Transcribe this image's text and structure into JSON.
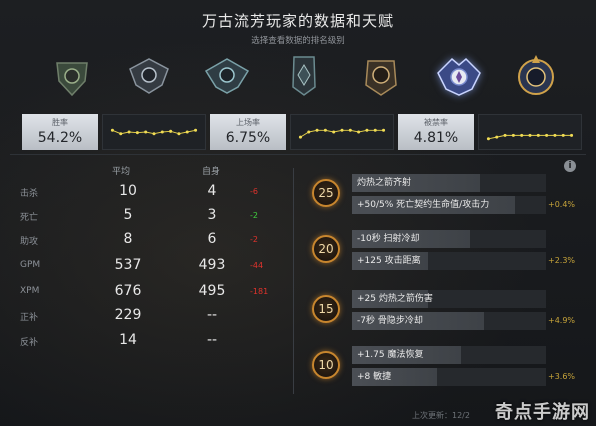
{
  "header": {
    "title": "万古流芳玩家的数据和天赋",
    "subtitle": "选择查看数据的排名级别"
  },
  "tiers": [
    {
      "icon": "herald-medal-icon",
      "active": false
    },
    {
      "icon": "guardian-medal-icon",
      "active": false
    },
    {
      "icon": "crusader-medal-icon",
      "active": false
    },
    {
      "icon": "archon-medal-icon",
      "active": false
    },
    {
      "icon": "legend-medal-icon",
      "active": false
    },
    {
      "icon": "ancient-medal-icon",
      "active": true
    },
    {
      "icon": "divine-medal-icon",
      "active": false
    }
  ],
  "stat_cards": [
    {
      "label": "胜率",
      "value": "54.2%",
      "trend": [
        0.55,
        0.45,
        0.5,
        0.48,
        0.5,
        0.45,
        0.5,
        0.52,
        0.45,
        0.5,
        0.55
      ]
    },
    {
      "label": "上场率",
      "value": "6.75%",
      "trend": [
        0.35,
        0.5,
        0.55,
        0.55,
        0.5,
        0.55,
        0.55,
        0.5,
        0.55,
        0.55,
        0.55
      ]
    },
    {
      "label": "被禁率",
      "value": "4.81%",
      "trend": [
        0.3,
        0.35,
        0.4,
        0.4,
        0.4,
        0.4,
        0.4,
        0.4,
        0.4,
        0.4,
        0.4
      ]
    }
  ],
  "table": {
    "avg_header": "平均",
    "self_header": "自身",
    "rows": [
      {
        "label": "击杀",
        "avg": "10",
        "self": "4",
        "diff": "-6",
        "sign": "neg"
      },
      {
        "label": "死亡",
        "avg": "5",
        "self": "3",
        "diff": "-2",
        "sign": "pos"
      },
      {
        "label": "助攻",
        "avg": "8",
        "self": "6",
        "diff": "-2",
        "sign": "neg"
      },
      {
        "label": "GPM",
        "avg": "537",
        "self": "493",
        "diff": "-44",
        "sign": "neg"
      },
      {
        "label": "XPM",
        "avg": "676",
        "self": "495",
        "diff": "-181",
        "sign": "neg"
      },
      {
        "label": "正补",
        "avg": "229",
        "self": "--",
        "diff": "",
        "sign": "neg"
      },
      {
        "label": "反补",
        "avg": "14",
        "self": "--",
        "diff": "",
        "sign": "neg"
      }
    ]
  },
  "talents": [
    {
      "level": "25",
      "top": {
        "text": "灼热之箭齐射",
        "fill": 0.66
      },
      "bottom": {
        "text": "+50/5% 死亡契约生命值/攻击力",
        "fill": 0.84
      },
      "pct": "+0.4%"
    },
    {
      "level": "20",
      "top": {
        "text": "-10秒 扫射冷却",
        "fill": 0.61
      },
      "bottom": {
        "text": "+125 攻击距离",
        "fill": 0.39
      },
      "pct": "+2.3%"
    },
    {
      "level": "15",
      "top": {
        "text": "+25 灼热之箭伤害",
        "fill": 0.39
      },
      "bottom": {
        "text": "-7秒 骨隐步冷却",
        "fill": 0.68
      },
      "pct": "+4.9%"
    },
    {
      "level": "10",
      "top": {
        "text": "+1.75 魔法恢复",
        "fill": 0.56
      },
      "bottom": {
        "text": "+8 敏捷",
        "fill": 0.44
      },
      "pct": "+3.6%"
    }
  ],
  "footer": {
    "updated_label": "上次更新：",
    "updated_value": "12/2"
  },
  "watermark": "奇点手游网",
  "colors": {
    "accent_gold": "#c8862e",
    "negative": "#e0332c",
    "positive": "#3fcf3f",
    "pct_gold": "#c7a43a"
  }
}
